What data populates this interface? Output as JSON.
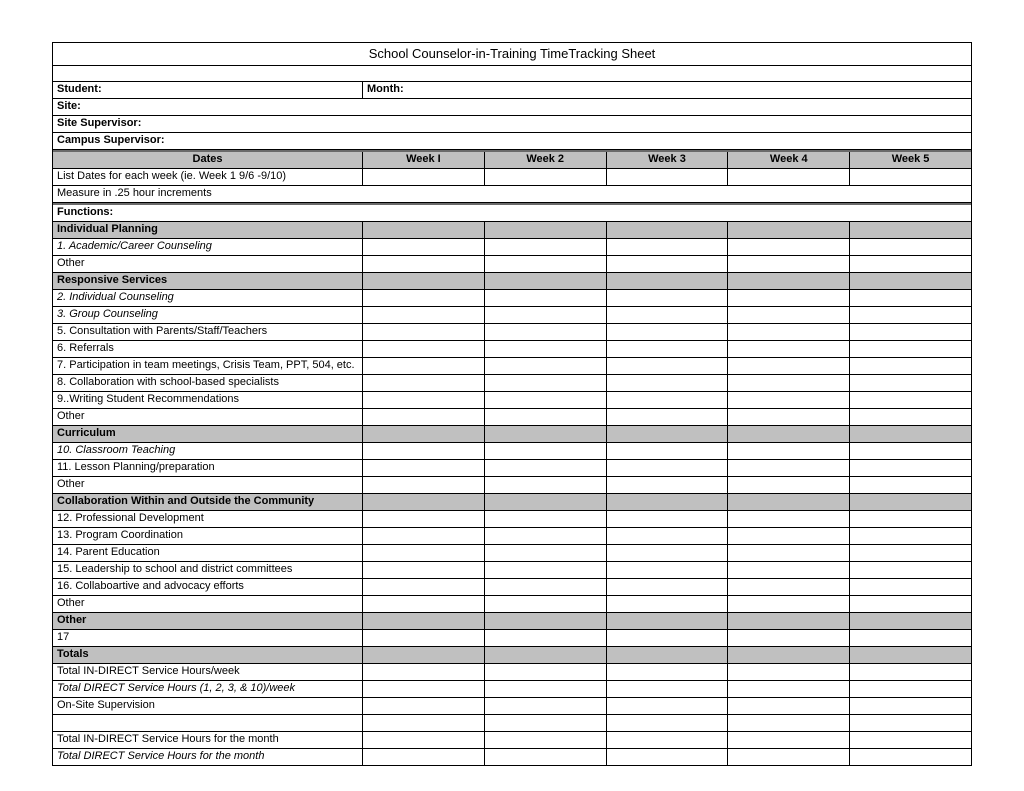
{
  "title": "School Counselor-in-Training TimeTracking Sheet",
  "info": {
    "student_label": "Student:",
    "month_label": "Month:",
    "site_label": "Site:",
    "site_supervisor_label": "Site Supervisor:",
    "campus_supervisor_label": "Campus Supervisor:"
  },
  "columns": {
    "dates": "Dates",
    "week1": "Week I",
    "week2": "Week 2",
    "week3": "Week 3",
    "week4": "Week 4",
    "week5": "Week 5"
  },
  "instructions": {
    "list_dates": "List Dates for each week (ie. Week 1 9/6 -9/10)",
    "measure": "Measure in .25 hour increments"
  },
  "sections": {
    "functions": "Functions:",
    "individual_planning": "Individual Planning",
    "responsive_services": "Responsive Services",
    "curriculum": "Curriculum",
    "collaboration": "Collaboration Within and Outside the Community",
    "other": "Other",
    "totals": "Totals"
  },
  "items": {
    "ip1": "1. Academic/Career Counseling",
    "ip_other": "Other",
    "rs2": "2. Individual Counseling",
    "rs3": "3. Group Counseling",
    "rs5": "5. Consultation with Parents/Staff/Teachers",
    "rs6": "6. Referrals",
    "rs7": "7. Participation in team meetings, Crisis Team, PPT, 504, etc.",
    "rs8": "8. Collaboration with school-based specialists",
    "rs9": "9..Writing Student Recommendations",
    "rs_other": "Other",
    "cu10": "10. Classroom Teaching",
    "cu11": "11. Lesson Planning/preparation",
    "cu_other": "Other",
    "co12": "12. Professional Development",
    "co13": "13. Program Coordination",
    "co14": "14. Parent Education",
    "co15": "15. Leadership to school and district committees",
    "co16": "16. Collaboartive and advocacy efforts",
    "co_other": "Other",
    "ot17": "17"
  },
  "totals": {
    "indirect_week": "Total IN-DIRECT Service Hours/week",
    "direct_week": "Total DIRECT Service Hours (1, 2, 3, & 10)/week",
    "onsite": "On-Site Supervision",
    "indirect_month": "Total IN-DIRECT Service Hours for the month",
    "direct_month": "Total DIRECT Service Hours for the month"
  }
}
